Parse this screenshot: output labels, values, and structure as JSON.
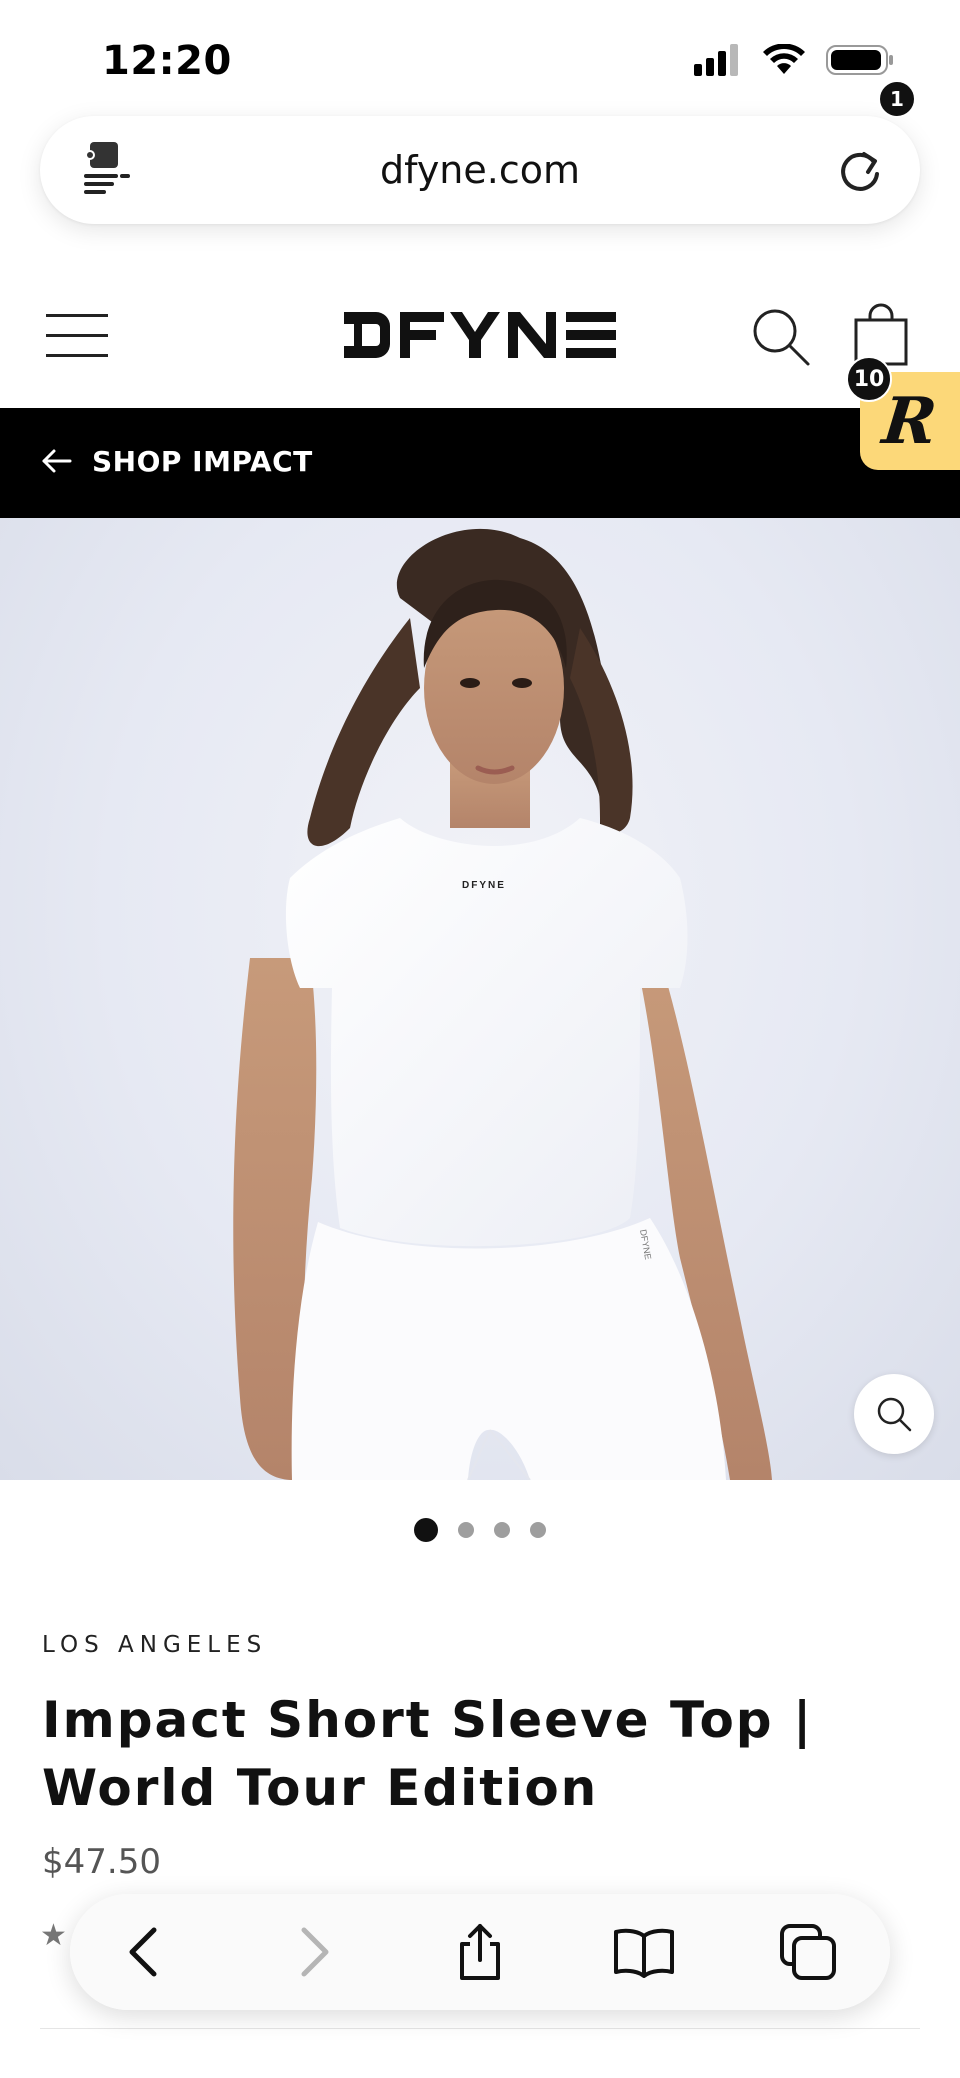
{
  "status_bar": {
    "time": "12:20"
  },
  "browser": {
    "url": "dfyne.com"
  },
  "header": {
    "logo": "DFYNE",
    "cart_count": "1",
    "rewards_count": "10",
    "rewards_letter": "R"
  },
  "banner": {
    "label": "SHOP IMPACT"
  },
  "hero": {
    "shirt_logo": "DFYNE",
    "waistband_text": "DFYNE"
  },
  "carousel": {
    "total": 4,
    "active": 1
  },
  "product": {
    "vendor": "LOS ANGELES",
    "title": "Impact Short Sleeve Top | World Tour Edition",
    "price": "$47.50"
  },
  "colors": {
    "banner_bg": "#000000",
    "rewards_bg": "#fcd879",
    "text": "#111111"
  },
  "icons": [
    "reader-icon",
    "reload-icon",
    "menu-icon",
    "search-icon",
    "bag-icon",
    "arrow-left-icon",
    "zoom-icon",
    "back-icon",
    "forward-icon",
    "share-icon",
    "bookmarks-icon",
    "tabs-icon"
  ]
}
